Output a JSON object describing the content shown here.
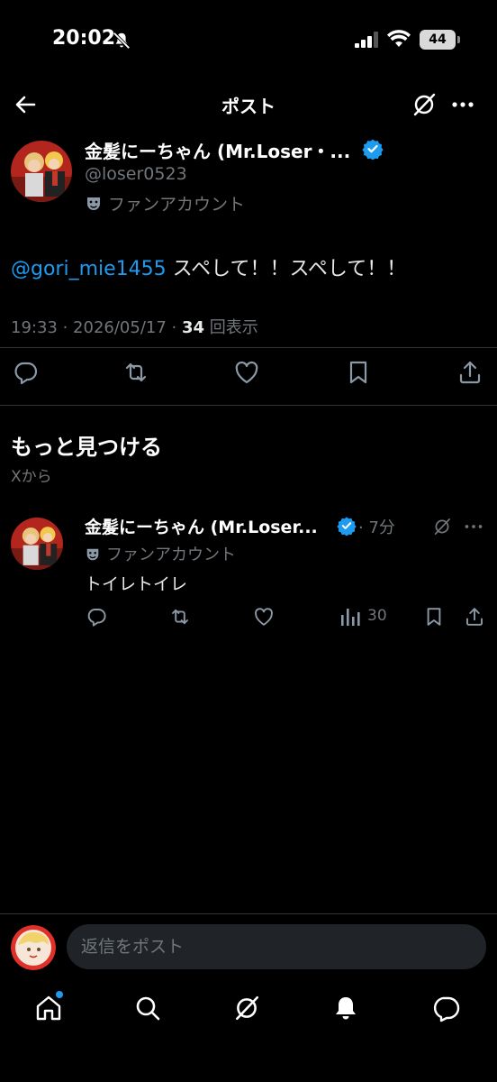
{
  "status_bar": {
    "time": "20:02",
    "battery": "44"
  },
  "header": {
    "title": "ポスト"
  },
  "main_post": {
    "author_name": "金髪にーちゃん (Mr.Loser・...",
    "handle": "@loser0523",
    "affiliation": "ファンアカウント",
    "mention": "@gori_mie1455",
    "text": " スペして！！スペして！！",
    "timestamp": "19:33 · 2026/05/17 · ",
    "views_count": "34",
    "views_label": " 回表示"
  },
  "discover": {
    "title": "もっと見つける",
    "subtitle": "Xから"
  },
  "related_post": {
    "author_name": "金髪にーちゃん (Mr.Loser...",
    "time": "· 7分",
    "affiliation": "ファンアカウント",
    "text": "トイレトイレ",
    "views": "30"
  },
  "reply": {
    "placeholder": "返信をポスト"
  },
  "colors": {
    "accent": "#1d9bf0",
    "background": "#000000",
    "muted": "#71767b",
    "divider": "#2f3336"
  },
  "icons": [
    "back-icon",
    "grok-icon",
    "more-icon",
    "verified-badge-icon",
    "theater-mask-icon",
    "reply-icon",
    "repost-icon",
    "like-icon",
    "bookmark-icon",
    "share-icon",
    "views-icon",
    "home-icon",
    "search-icon",
    "notifications-icon",
    "messages-icon"
  ]
}
